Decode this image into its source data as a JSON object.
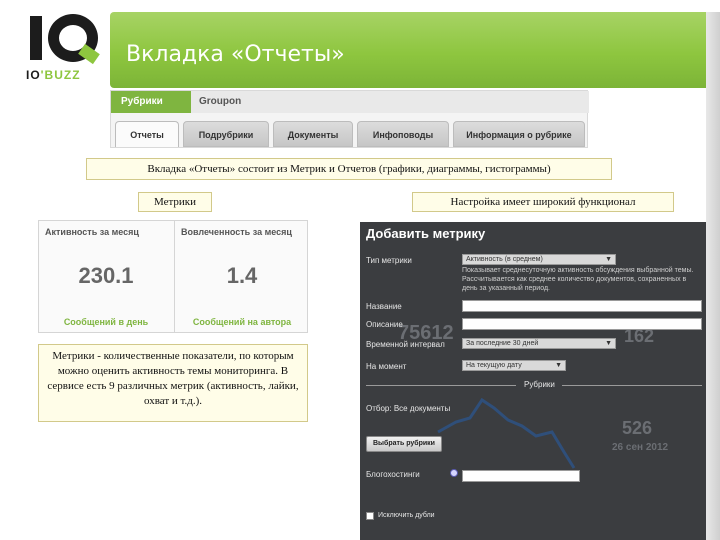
{
  "logo": {
    "brand": "IQ",
    "text_main": "IO",
    "text_accent": "'BUZZ"
  },
  "slide": {
    "title": "Вкладка «Отчеты»"
  },
  "tabs_screenshot": {
    "top_tab": "Рубрики",
    "top_group": "Groupon",
    "tabs": [
      {
        "label": "Отчеты",
        "active": true
      },
      {
        "label": "Подрубрики",
        "active": false
      },
      {
        "label": "Документы",
        "active": false
      },
      {
        "label": "Инфоповоды",
        "active": false
      },
      {
        "label": "Информация о рубрике",
        "active": false
      }
    ]
  },
  "captions": {
    "intro": "Вкладка «Отчеты» состоит из Метрик и Отчетов (графики, диаграммы, гистограммы)",
    "metrics": "Метрики",
    "settings": "Настройка имеет широкий функционал"
  },
  "metrics_card": [
    {
      "header": "Активность за месяц",
      "value": "230.1",
      "footer": "Сообщений в день"
    },
    {
      "header": "Вовлеченность за месяц",
      "value": "1.4",
      "footer": "Сообщений на автора"
    }
  ],
  "description": "Метрики - количественные показатели, по которым можно оценить активность темы мониторинга. В сервисе есть 9 различных метрик (активность, лайки, охват и т.д.).",
  "dialog": {
    "title": "Добавить метрику",
    "fields": {
      "type_label": "Тип метрики",
      "type_value": "Активность (в среднем)",
      "hint": "Показывает среднесуточную активность обсуждения выбранной темы. Рассчитывается как среднее количество документов, сохраненных в день за указанный период.",
      "name_label": "Название",
      "desc_label": "Описание",
      "interval_label": "Временной интервал",
      "interval_value": "За последние 30 дней",
      "moment_label": "На момент",
      "moment_value": "На текущую дату",
      "section_label": "Рубрики",
      "sources_label": "Отбор: Все документы",
      "choose_button": "Выбрать рубрики",
      "blogs_label": "Блогохостинги",
      "exclude_label": "Исключить дубли"
    },
    "background": {
      "num1": "75612",
      "num2": "162",
      "num3": "526",
      "date": "26 сен 2012"
    }
  },
  "colors": {
    "accent": "#8ec63f",
    "dark_panel": "#3b3d40"
  }
}
